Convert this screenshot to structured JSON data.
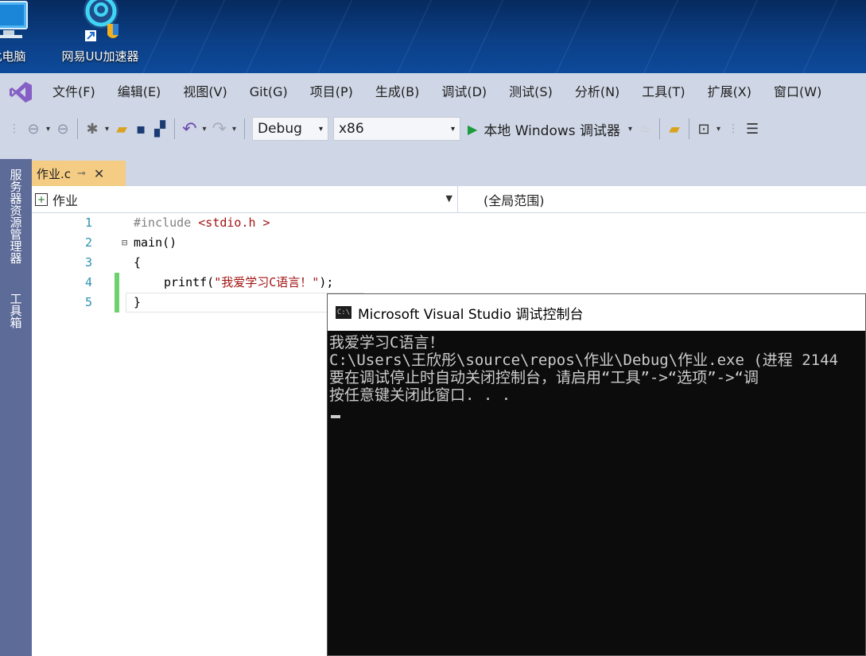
{
  "desktop": {
    "icons": [
      {
        "label": "此电脑"
      },
      {
        "label": "网易UU加速器"
      }
    ]
  },
  "menubar": {
    "items": [
      "文件(F)",
      "编辑(E)",
      "视图(V)",
      "Git(G)",
      "项目(P)",
      "生成(B)",
      "调试(D)",
      "测试(S)",
      "分析(N)",
      "工具(T)",
      "扩展(X)",
      "窗口(W)"
    ]
  },
  "toolbar": {
    "config": "Debug",
    "platform": "x86",
    "run_label": "本地 Windows 调试器"
  },
  "sidebar": {
    "server_explorer": "服务器资源管理器",
    "toolbox": "工具箱"
  },
  "tabs": [
    {
      "label": "作业.c",
      "active": true
    }
  ],
  "navbar": {
    "project": "作业",
    "scope": "(全局范围)"
  },
  "editor": {
    "lines": [
      {
        "number": "1",
        "pre": "#include ",
        "str": "<stdio.h >",
        "rest": ""
      },
      {
        "number": "2",
        "pre": "",
        "str": "",
        "rest": "main()"
      },
      {
        "number": "3",
        "pre": "",
        "str": "",
        "rest": "{"
      },
      {
        "number": "4",
        "pre": "",
        "str": "\"我爱学习C语言！\"",
        "rest": "printf(",
        "tail": ");"
      },
      {
        "number": "5",
        "pre": "",
        "str": "",
        "rest": "}"
      }
    ]
  },
  "console": {
    "title": "Microsoft Visual Studio 调试控制台",
    "icon_text": "C:\\",
    "lines": [
      "我爱学习C语言！",
      "C:\\Users\\王欣彤\\source\\repos\\作业\\Debug\\作业.exe (进程 2144",
      "要在调试停止时自动关闭控制台，请启用“工具”->“选项”->“调",
      "按任意键关闭此窗口. . ."
    ]
  },
  "colors": {
    "menubar_bg": "#cfd6e5",
    "sidebar_bg": "#5d6b99",
    "active_tab": "#f5cc84",
    "console_bg": "#0c0c0c",
    "vs_purple": "#865fc5"
  }
}
